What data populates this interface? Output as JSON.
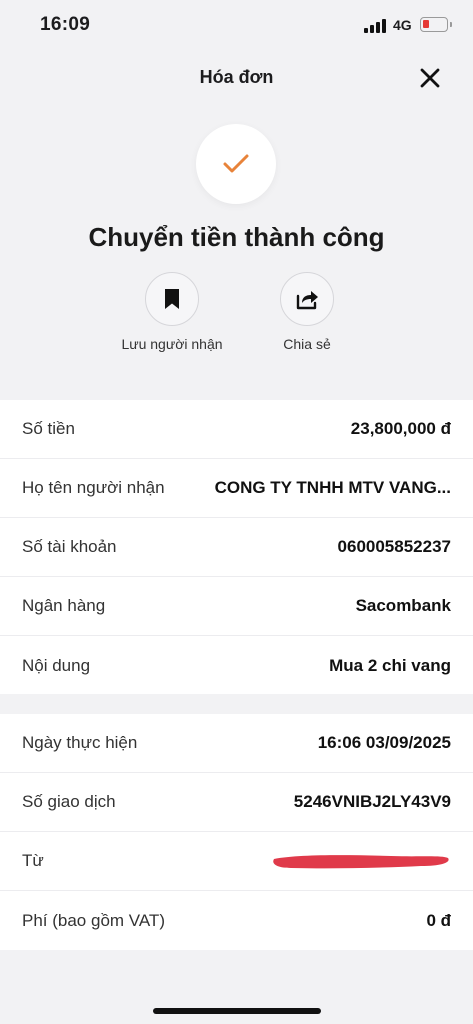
{
  "status_bar": {
    "time": "16:09",
    "network": "4G"
  },
  "header": {
    "title": "Hóa đơn"
  },
  "result": {
    "title": "Chuyển tiền thành công",
    "accent_color": "#e8833a"
  },
  "actions": [
    {
      "label": "Lưu người nhận",
      "icon": "bookmark-icon"
    },
    {
      "label": "Chia sẻ",
      "icon": "share-icon"
    }
  ],
  "transfer_details": {
    "amount_label": "Số tiền",
    "amount_value": "23,800,000 đ",
    "recipient_label": "Họ tên người nhận",
    "recipient_value": "CONG TY TNHH MTV VANG...",
    "account_label": "Số tài khoản",
    "account_value": "060005852237",
    "bank_label": "Ngân hàng",
    "bank_value": "Sacombank",
    "content_label": "Nội dung",
    "content_value": "Mua 2 chi vang"
  },
  "transaction_info": {
    "date_label": "Ngày thực hiện",
    "date_value": "16:06 03/09/2025",
    "txn_label": "Số giao dịch",
    "txn_value": "5246VNIBJ2LY43V9",
    "from_label": "Từ",
    "fee_label": "Phí (bao gồm VAT)",
    "fee_value": "0 đ"
  }
}
